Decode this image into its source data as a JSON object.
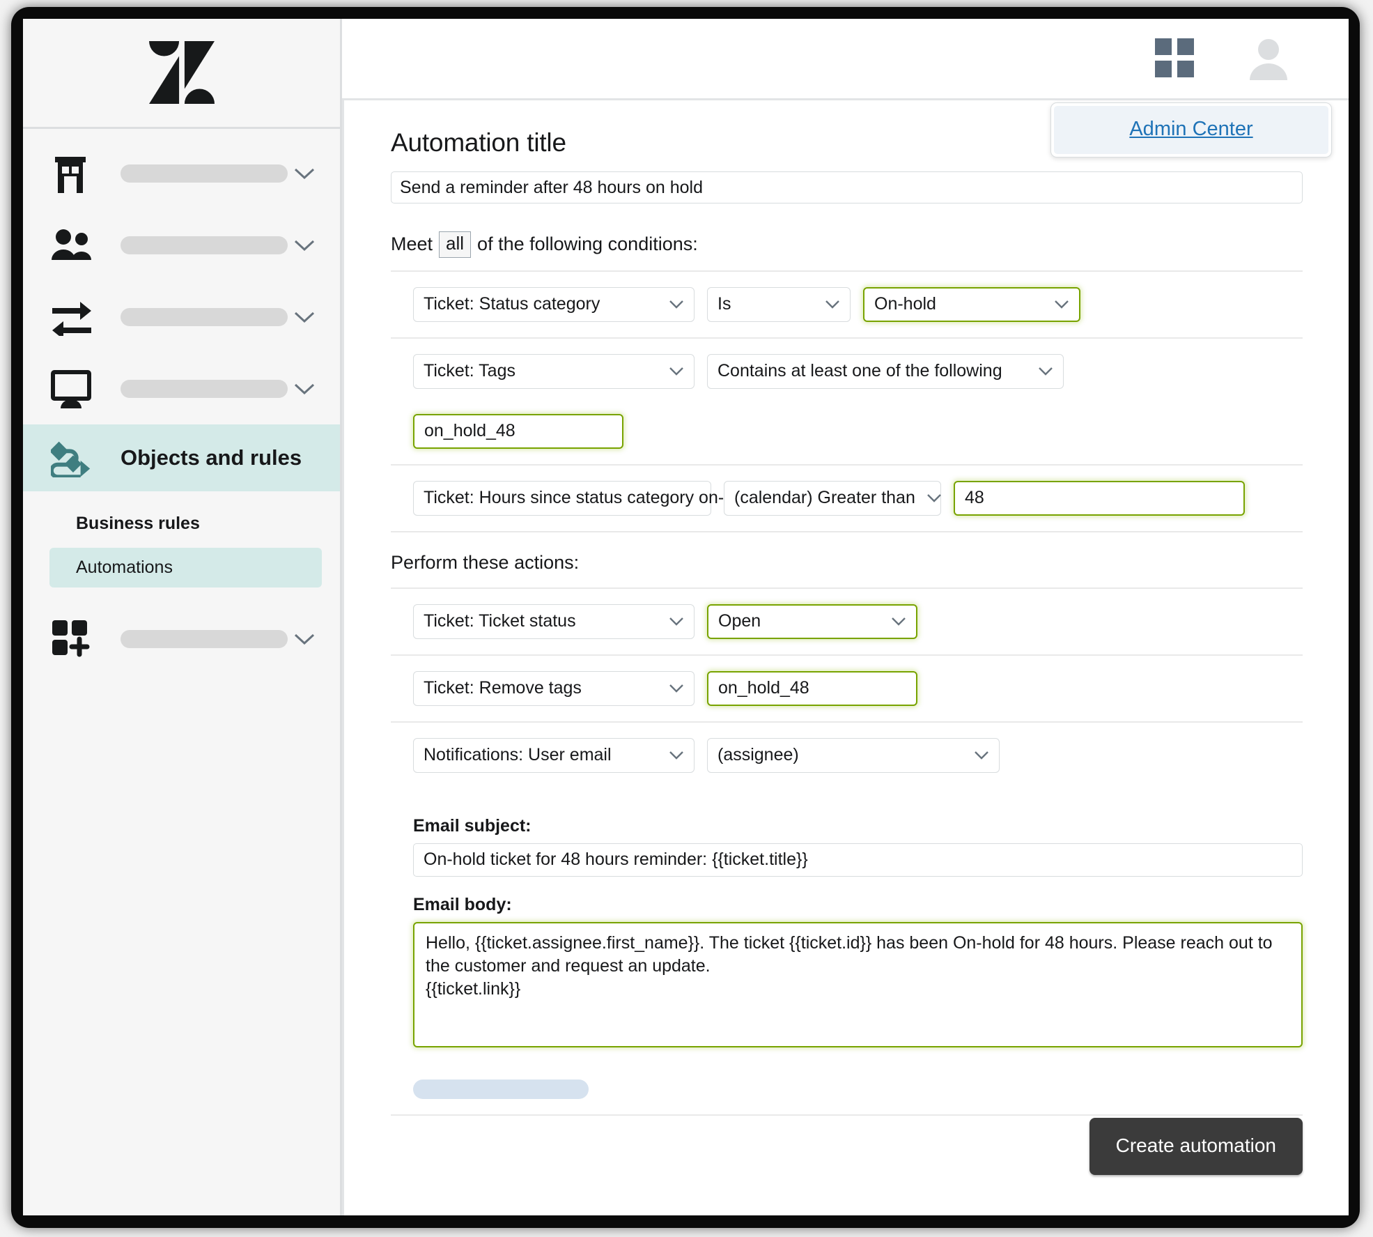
{
  "window": {
    "brand_logo": "zendesk-logo"
  },
  "sidebar": {
    "nav_items": [
      {
        "icon": "building-icon",
        "label": ""
      },
      {
        "icon": "people-icon",
        "label": ""
      },
      {
        "icon": "transfer-arrows-icon",
        "label": ""
      },
      {
        "icon": "monitor-icon",
        "label": ""
      }
    ],
    "active_item": {
      "icon": "objects-rules-flow-icon",
      "label": "Objects and rules"
    },
    "sub_items": [
      {
        "label": "Business rules",
        "selected": false
      },
      {
        "label": "Automations",
        "selected": true
      }
    ],
    "bottom_item": {
      "icon": "apps-add-icon",
      "label": ""
    }
  },
  "topbar": {
    "grid_icon": "grid-apps-icon",
    "avatar_icon": "user-avatar-icon",
    "popover": {
      "link_label": "Admin Center"
    }
  },
  "form": {
    "page_title": "Automation title",
    "title_value": "Send a reminder after 48 hours on hold",
    "title_placeholder": "Automation title",
    "meet_prefix": "Meet",
    "meet_selector": "all",
    "meet_suffix": "of the following conditions:",
    "actions_heading": "Perform these actions:",
    "conditions": [
      {
        "field": "Ticket: Status category",
        "operator": "Is",
        "value": "On-hold",
        "value_highlighted": true
      },
      {
        "field": "Ticket: Tags",
        "operator": "Contains at least one of the following",
        "value": "on_hold_48",
        "value_highlighted": true
      },
      {
        "field": "Ticket: Hours since status category on-hold",
        "operator": "(calendar) Greater than",
        "value": "48",
        "value_highlighted": true
      }
    ],
    "actions": [
      {
        "field": "Ticket: Ticket status",
        "value": "Open",
        "value_highlighted": true
      },
      {
        "field": "Ticket: Remove tags",
        "value": "on_hold_48",
        "value_highlighted": true
      },
      {
        "field": "Notifications: User email",
        "value": "(assignee)",
        "value_highlighted": false
      }
    ],
    "email_subject_label": "Email subject:",
    "email_subject_value": "On-hold ticket for 48 hours reminder: {{ticket.title}}",
    "email_body_label": "Email body:",
    "email_body_value": "Hello, {{ticket.assignee.first_name}}. The ticket {{ticket.id}} has been On-hold for 48 hours. Please reach out to the customer and request an update.\n{{ticket.link}}"
  },
  "footer": {
    "create_button_label": "Create automation"
  },
  "colors": {
    "accent_green": "#78a300",
    "sidebar_active": "#d4eae8",
    "link_blue": "#1f73b7",
    "button_dark": "#3b3b3b"
  }
}
